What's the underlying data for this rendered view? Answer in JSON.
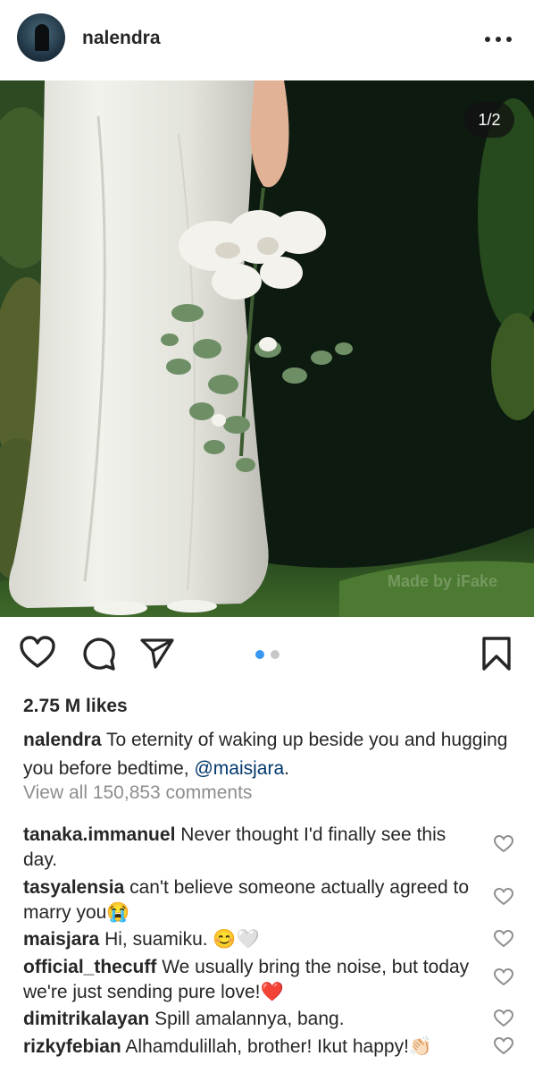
{
  "post": {
    "username": "nalendra",
    "photo_counter": "1/2",
    "watermark": "Made by iFake",
    "likes": "2.75 M likes",
    "caption_user": "nalendra",
    "caption_text": " To eternity of waking up beside you and hugging you before bedtime, ",
    "caption_mention": "@maisjara",
    "caption_end": ".",
    "view_all": "View all 150,853 comments",
    "carousel_total": 2,
    "carousel_active": 1
  },
  "icons": {
    "avatar": "avatar",
    "more": "more-options-icon",
    "like": "heart-icon",
    "comment": "comment-bubble-icon",
    "share": "paper-plane-icon",
    "save": "bookmark-icon",
    "comment_like": "small-heart-icon"
  },
  "colors": {
    "text": "#262626",
    "muted": "#8e8e8e",
    "mention": "#00376b",
    "carousel_active": "#3897f0",
    "carousel_inactive": "#c7c7c7"
  },
  "comments": [
    {
      "user": "tanaka.immanuel",
      "text": " Never thought I'd finally see this day."
    },
    {
      "user": "tasyalensia",
      "text": " can't believe someone actually agreed to marry you😭"
    },
    {
      "user": "maisjara",
      "text": " Hi, suamiku. 😊🤍"
    },
    {
      "user": "official_thecuff",
      "text": " We usually bring the noise, but today we're just sending pure love!❤️"
    },
    {
      "user": "dimitrikalayan",
      "text": " Spill amalannya, bang."
    },
    {
      "user": "rizkyfebian",
      "text": " Alhamdulillah, brother! Ikut happy!👏🏻"
    }
  ]
}
